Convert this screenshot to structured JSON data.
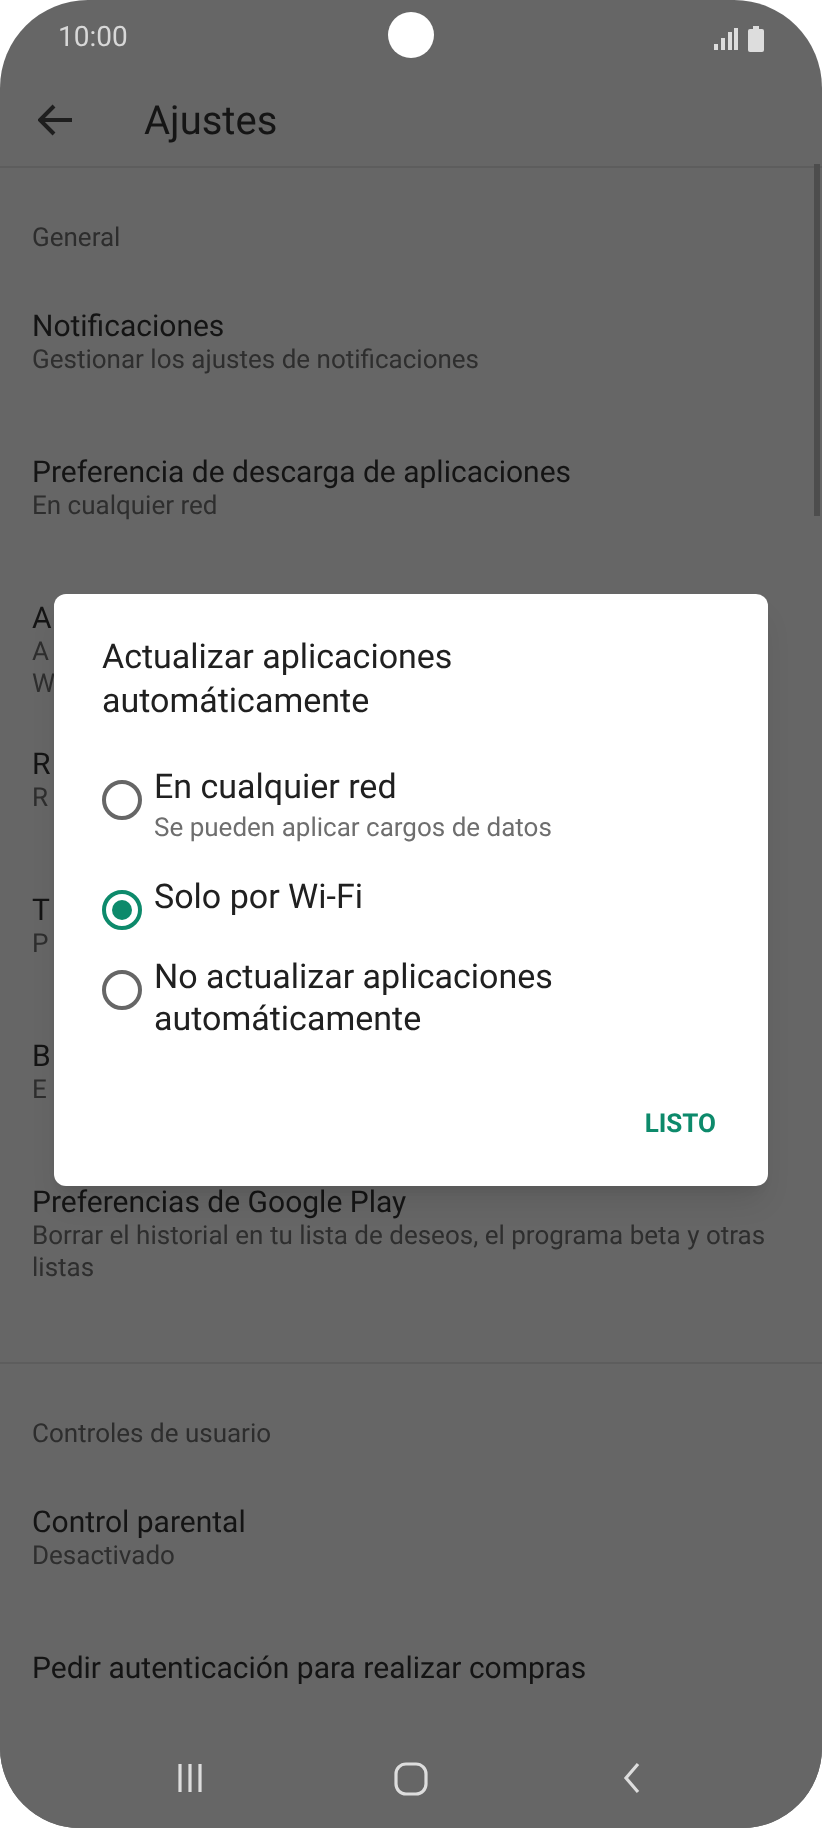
{
  "status_bar": {
    "time": "10:00"
  },
  "toolbar": {
    "title": "Ajustes"
  },
  "sections": [
    {
      "header": "General",
      "items": [
        {
          "title": "Notificaciones",
          "subtitle_lines": [
            "Gestionar los ajustes de notificaciones"
          ]
        },
        {
          "title": "Preferencia de descarga de aplicaciones",
          "subtitle_lines": [
            "En cualquier red"
          ]
        },
        {
          "title": "A",
          "subtitle_lines": [
            "A",
            "W"
          ]
        },
        {
          "title": "R",
          "subtitle_lines": [
            "R"
          ]
        },
        {
          "title": "T",
          "subtitle_lines": [
            "P"
          ]
        },
        {
          "title": "B",
          "subtitle_lines": [
            "E"
          ]
        },
        {
          "title": "Preferencias de Google Play",
          "subtitle_lines": [
            "Borrar el historial en tu lista de deseos, el programa beta y otras listas"
          ]
        }
      ]
    },
    {
      "header": "Controles de usuario",
      "items": [
        {
          "title": "Control parental",
          "subtitle_lines": [
            "Desactivado"
          ]
        },
        {
          "title": "Pedir autenticación para realizar compras"
        }
      ]
    }
  ],
  "dialog": {
    "title": "Actualizar aplicaciones automáticamente",
    "options": [
      {
        "label": "En cualquier red",
        "hint": "Se pueden aplicar cargos de datos",
        "selected": false
      },
      {
        "label": "Solo por Wi-Fi",
        "selected": true
      },
      {
        "label": "No actualizar aplicaciones automáticamente",
        "selected": false
      }
    ],
    "button": "LISTO"
  }
}
